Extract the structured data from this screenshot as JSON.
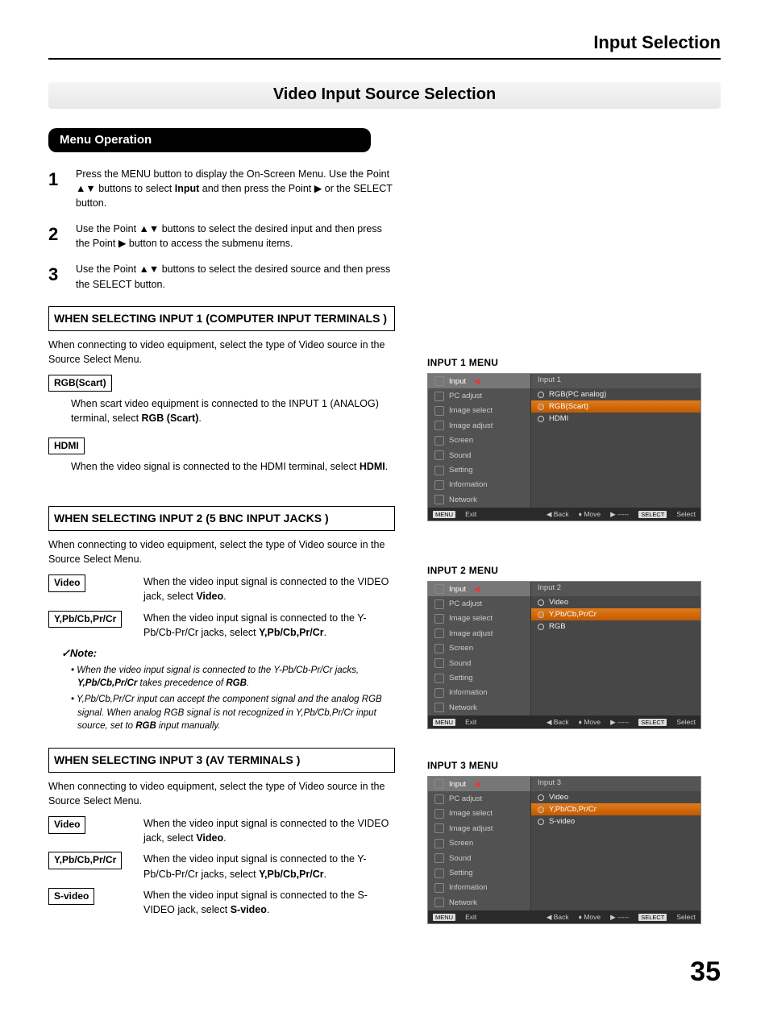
{
  "header": {
    "chapter": "Input Selection"
  },
  "title": "Video Input Source Selection",
  "menu_op": "Menu Operation",
  "steps": [
    {
      "num": "1",
      "text_a": "Press the MENU button to display the On-Screen Menu. Use the Point ▲▼ buttons to select ",
      "bold1": "Input",
      "text_b": " and then press the Point ▶ or the SELECT button."
    },
    {
      "num": "2",
      "text_a": "Use the Point ▲▼ buttons to select the desired input and then press the Point ▶ button to access the submenu items.",
      "bold1": "",
      "text_b": ""
    },
    {
      "num": "3",
      "text_a": "Use the Point ▲▼ buttons to select the desired source and then press the SELECT button.",
      "bold1": "",
      "text_b": ""
    }
  ],
  "s1": {
    "head": "WHEN SELECTING INPUT 1 (COMPUTER INPUT TERMINALS )",
    "intro": "When connecting to video equipment, select the type of Video source in the Source Select Menu.",
    "opt1_label": "RGB(Scart)",
    "opt1_a": "When scart video equipment is connected to the INPUT 1 (ANALOG) terminal, select ",
    "opt1_b": "RGB (Scart)",
    "opt1_c": ".",
    "opt2_label": "HDMI",
    "opt2_a": "When the video signal is connected to the HDMI terminal, select ",
    "opt2_b": "HDMI",
    "opt2_c": "."
  },
  "s2": {
    "head": "WHEN SELECTING INPUT 2 (5 BNC INPUT JACKS )",
    "intro": "When connecting to video equipment, select the type of Video source in the Source Select Menu.",
    "opt1_label": "Video",
    "opt1_a": "When the video input signal is connected to the VIDEO jack, select ",
    "opt1_b": "Video",
    "opt1_c": ".",
    "opt2_label": "Y,Pb/Cb,Pr/Cr",
    "opt2_a": "When the video input signal is connected to the Y-Pb/Cb-Pr/Cr jacks, select ",
    "opt2_b": "Y,Pb/Cb,Pr/Cr",
    "opt2_c": ".",
    "note_head": "Note:",
    "note1_a": "When the video input signal is connected to the Y-Pb/Cb-Pr/Cr jacks, ",
    "note1_b": "Y,Pb/Cb,Pr/Cr",
    "note1_c": " takes precedence of ",
    "note1_d": "RGB",
    "note1_e": ".",
    "note2_a": "Y,Pb/Cb,Pr/Cr input can accept the component signal and the analog RGB signal. When analog RGB signal is not recognized in Y,Pb/Cb,Pr/Cr input source, set to ",
    "note2_b": "RGB",
    "note2_c": " input manually."
  },
  "s3": {
    "head": "WHEN SELECTING INPUT 3 (AV TERMINALS )",
    "intro": "When connecting to video equipment, select the type of Video source in the Source Select Menu.",
    "opt1_label": "Video",
    "opt1_a": "When the video input signal is connected to the VIDEO jack, select ",
    "opt1_b": "Video",
    "opt1_c": ".",
    "opt2_label": "Y,Pb/Cb,Pr/Cr",
    "opt2_a": "When the video input signal is connected to the Y-Pb/Cb-Pr/Cr jacks, select ",
    "opt2_b": "Y,Pb/Cb,Pr/Cr",
    "opt2_c": ".",
    "opt3_label": "S-video",
    "opt3_a": "When the video input signal is connected to the S-VIDEO jack, select ",
    "opt3_b": "S-video",
    "opt3_c": "."
  },
  "osd_common": {
    "left_items": [
      "Input",
      "PC adjust",
      "Image select",
      "Image adjust",
      "Screen",
      "Sound",
      "Setting",
      "Information",
      "Network"
    ],
    "foot": {
      "menu": "MENU",
      "exit": "Exit",
      "back": "◀ Back",
      "move": "♦ Move",
      "dash": "▶ -----",
      "select_btn": "SELECT",
      "select": "Select"
    }
  },
  "menu1": {
    "label": "INPUT 1 MENU",
    "hdr": "Input 1",
    "rows": [
      {
        "t": "RGB(PC analog)",
        "sel": false,
        "fill": false
      },
      {
        "t": "RGB(Scart)",
        "sel": true,
        "fill": true
      },
      {
        "t": "HDMI",
        "sel": false,
        "fill": false
      }
    ]
  },
  "menu2": {
    "label": "INPUT 2 MENU",
    "hdr": "Input 2",
    "rows": [
      {
        "t": "Video",
        "sel": false,
        "fill": false
      },
      {
        "t": "Y,Pb/Cb,Pr/Cr",
        "sel": true,
        "fill": true
      },
      {
        "t": "RGB",
        "sel": false,
        "fill": false
      }
    ]
  },
  "menu3": {
    "label": "INPUT 3 MENU",
    "hdr": "Input 3",
    "rows": [
      {
        "t": "Video",
        "sel": false,
        "fill": false
      },
      {
        "t": "Y,Pb/Cb,Pr/Cr",
        "sel": true,
        "fill": true
      },
      {
        "t": "S-video",
        "sel": false,
        "fill": false
      }
    ]
  },
  "page_num": "35"
}
